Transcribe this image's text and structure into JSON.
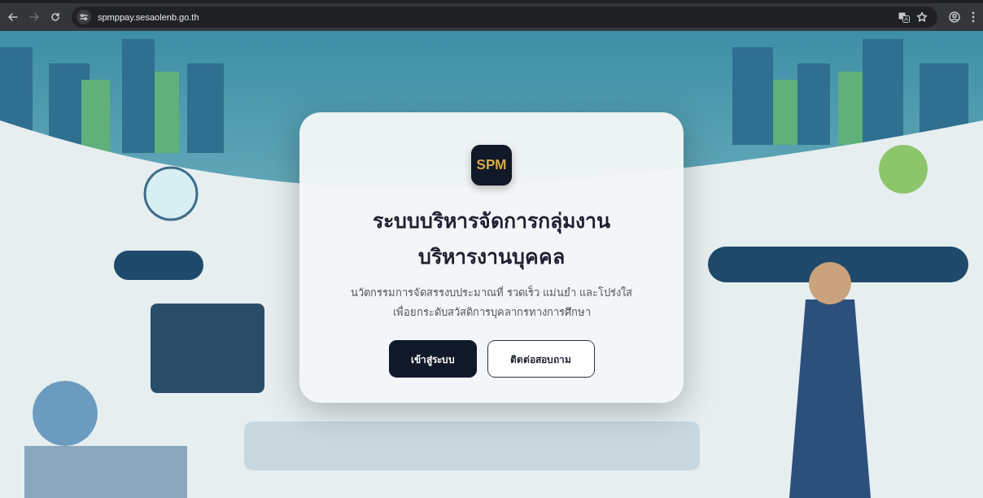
{
  "browser": {
    "url": "spmppay.sesaolenb.go.th"
  },
  "modal": {
    "logo": "SPM",
    "title": "ระบบบริหารจัดการกลุ่มงาน\nบริหารงานบุคคล",
    "subtitle": "นวัตกรรมการจัดสรรงบประมาณที่ รวดเร็ว แม่นยำ และโปร่งใส\nเพื่อยกระดับสวัสดิการบุคลากรทางการศึกษา",
    "buttons": [
      {
        "label": "เข้าสู่ระบบ",
        "kind": "primary"
      },
      {
        "label": "ติดต่อสอบถาม",
        "kind": "outline"
      }
    ]
  }
}
